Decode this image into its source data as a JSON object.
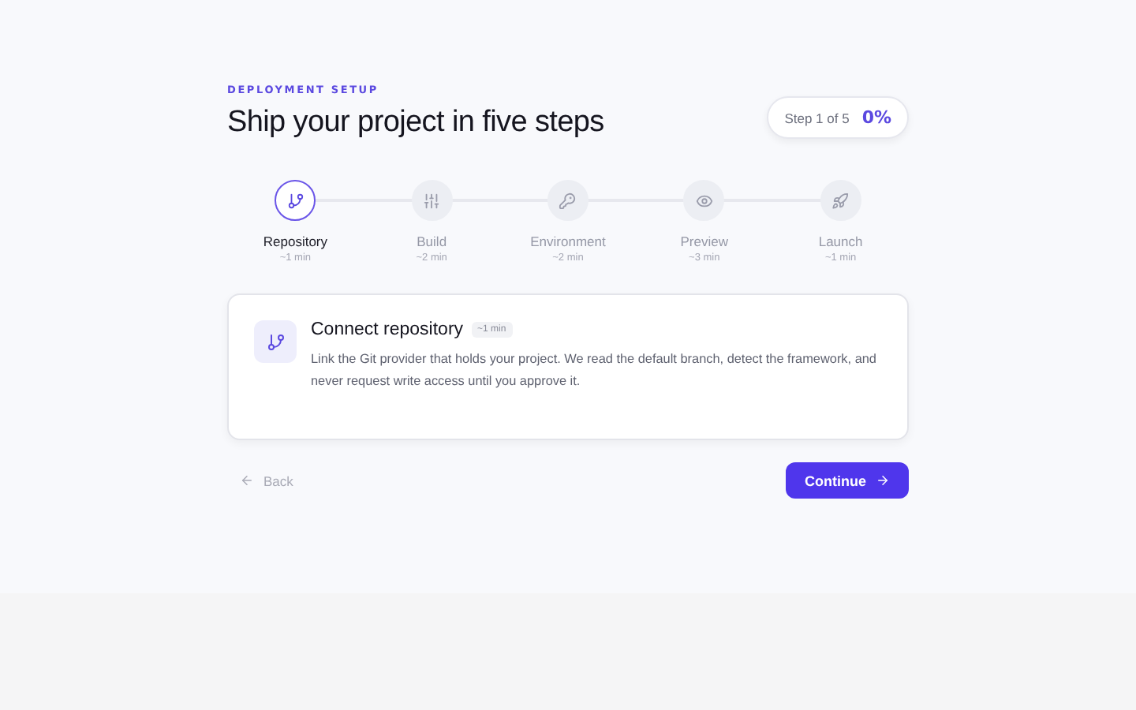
{
  "eyebrow": "DEPLOYMENT SETUP",
  "title": "Ship your project in five steps",
  "progress": {
    "step": "Step 1 of 5",
    "percent": "0%"
  },
  "steps": [
    {
      "label": "Repository",
      "time": "~1 min",
      "selected": true
    },
    {
      "label": "Build",
      "time": "~2 min",
      "selected": false
    },
    {
      "label": "Environment",
      "time": "~2 min",
      "selected": false
    },
    {
      "label": "Preview",
      "time": "~3 min",
      "selected": false
    },
    {
      "label": "Launch",
      "time": "~1 min",
      "selected": false
    }
  ],
  "card": {
    "title": "Connect repository",
    "badge": "~1 min",
    "body": "Link the Git provider that holds your project. We read the default branch, detect the framework, and never request write access until you approve it."
  },
  "back": {
    "label": "Back",
    "disabled": true
  },
  "continue": {
    "label": "Continue"
  }
}
